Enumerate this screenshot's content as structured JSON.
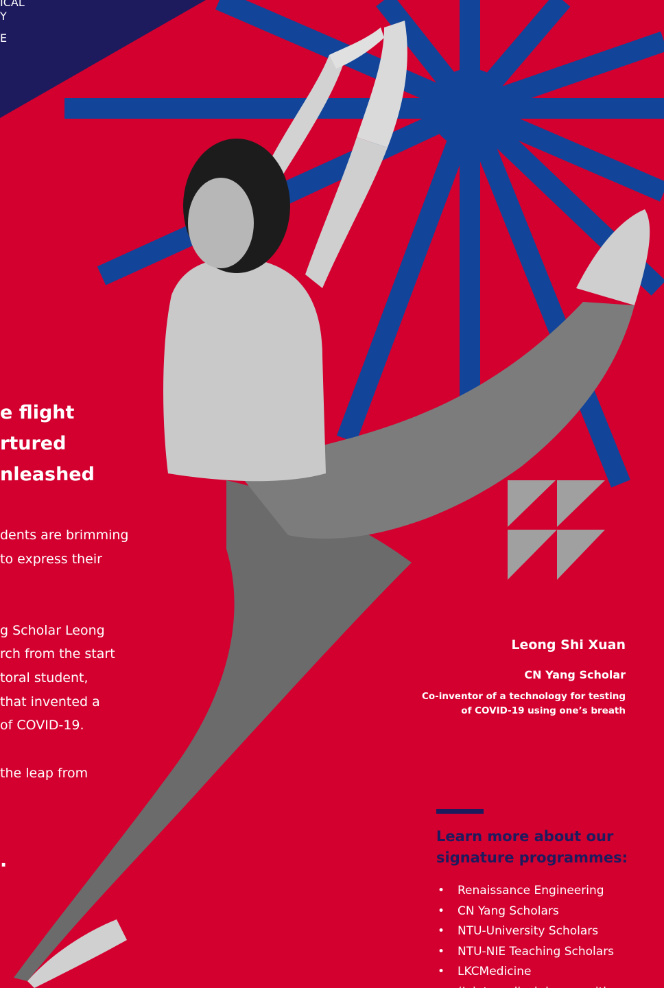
{
  "top_left_fragments": [
    "ICAL",
    "Y",
    "E"
  ],
  "heading_lines": [
    "e flight",
    "rtured",
    "nleashed"
  ],
  "body_paragraphs": [
    [
      "dents are brimming",
      "to express their"
    ],
    [
      "g Scholar Leong",
      "rch from the start",
      "toral student,",
      "that invented a",
      "of COVID-19."
    ],
    [
      "the leap from"
    ],
    [
      "."
    ]
  ],
  "quote": {
    "name": "Leong Shi Xuan",
    "title": "CN Yang Scholar",
    "description_lines": [
      "Co-inventor of a technology for testing",
      "of COVID-19 using one’s breath"
    ]
  },
  "learn_more": {
    "heading_lines": [
      "Learn more about our",
      "signature programmes:"
    ],
    "programmes": [
      "Renaissance Engineering",
      "CN Yang Scholars",
      "NTU-University Scholars",
      "NTU-NIE Teaching Scholars",
      "LKCMedicine",
      "(Joint medical degree with"
    ]
  },
  "colors": {
    "background": "#d3002f",
    "navy": "#1e1a5e",
    "starburst_blue": "#12449a",
    "quote_mark_gray": "#a0a0a0",
    "text": "#ffffff"
  }
}
